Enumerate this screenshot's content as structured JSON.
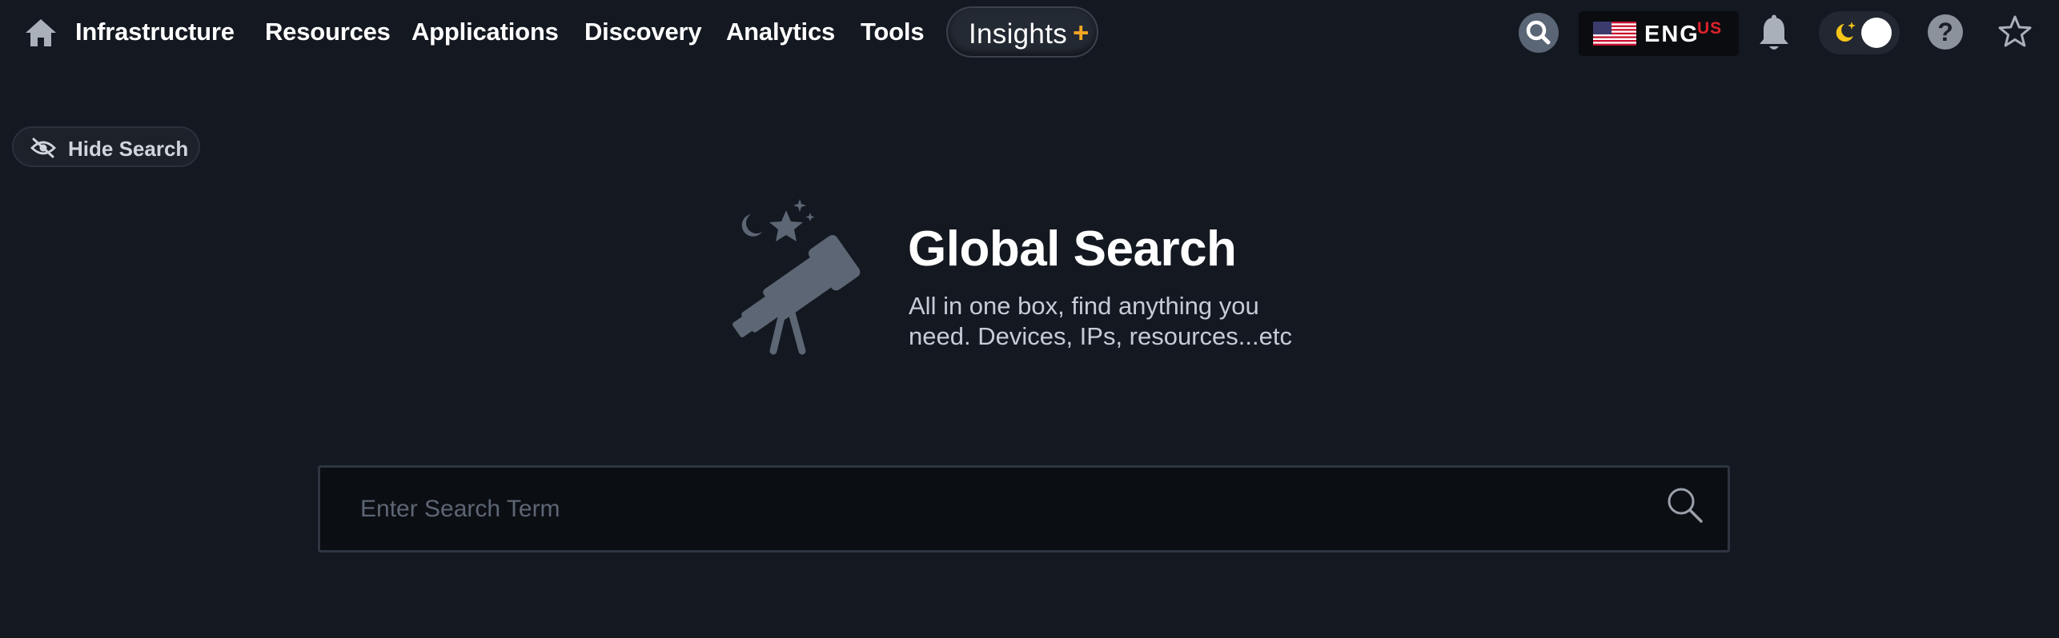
{
  "nav": {
    "items": [
      {
        "label": "Infrastructure"
      },
      {
        "label": "Resources"
      },
      {
        "label": "Applications"
      },
      {
        "label": "Discovery"
      },
      {
        "label": "Analytics"
      },
      {
        "label": "Tools"
      }
    ],
    "insights": {
      "label": "Insights",
      "plus": "+",
      "plus_color": "#f5a623"
    },
    "icons": {
      "home": "home-icon",
      "search": "search-icon",
      "bell": "bell-icon",
      "help": "help-icon",
      "favorite": "star-icon",
      "theme": "moon-icon"
    }
  },
  "language": {
    "code": "ENG",
    "region": "US",
    "flag": "us-flag-icon"
  },
  "help_symbol": "?",
  "hide_search": {
    "label": "Hide Search",
    "icon": "eye-slash-icon"
  },
  "hero": {
    "title": "Global Search",
    "subtitle_line1": "All in one box, find anything you",
    "subtitle_line2": "need. Devices, IPs, resources...etc",
    "illustration": "telescope-icon"
  },
  "search": {
    "placeholder": "Enter Search Term",
    "value": "",
    "icon": "search-icon"
  },
  "colors": {
    "background": "#141820",
    "accent": "#f5a623",
    "moon": "#f5c518",
    "region_red": "#e0222a"
  }
}
